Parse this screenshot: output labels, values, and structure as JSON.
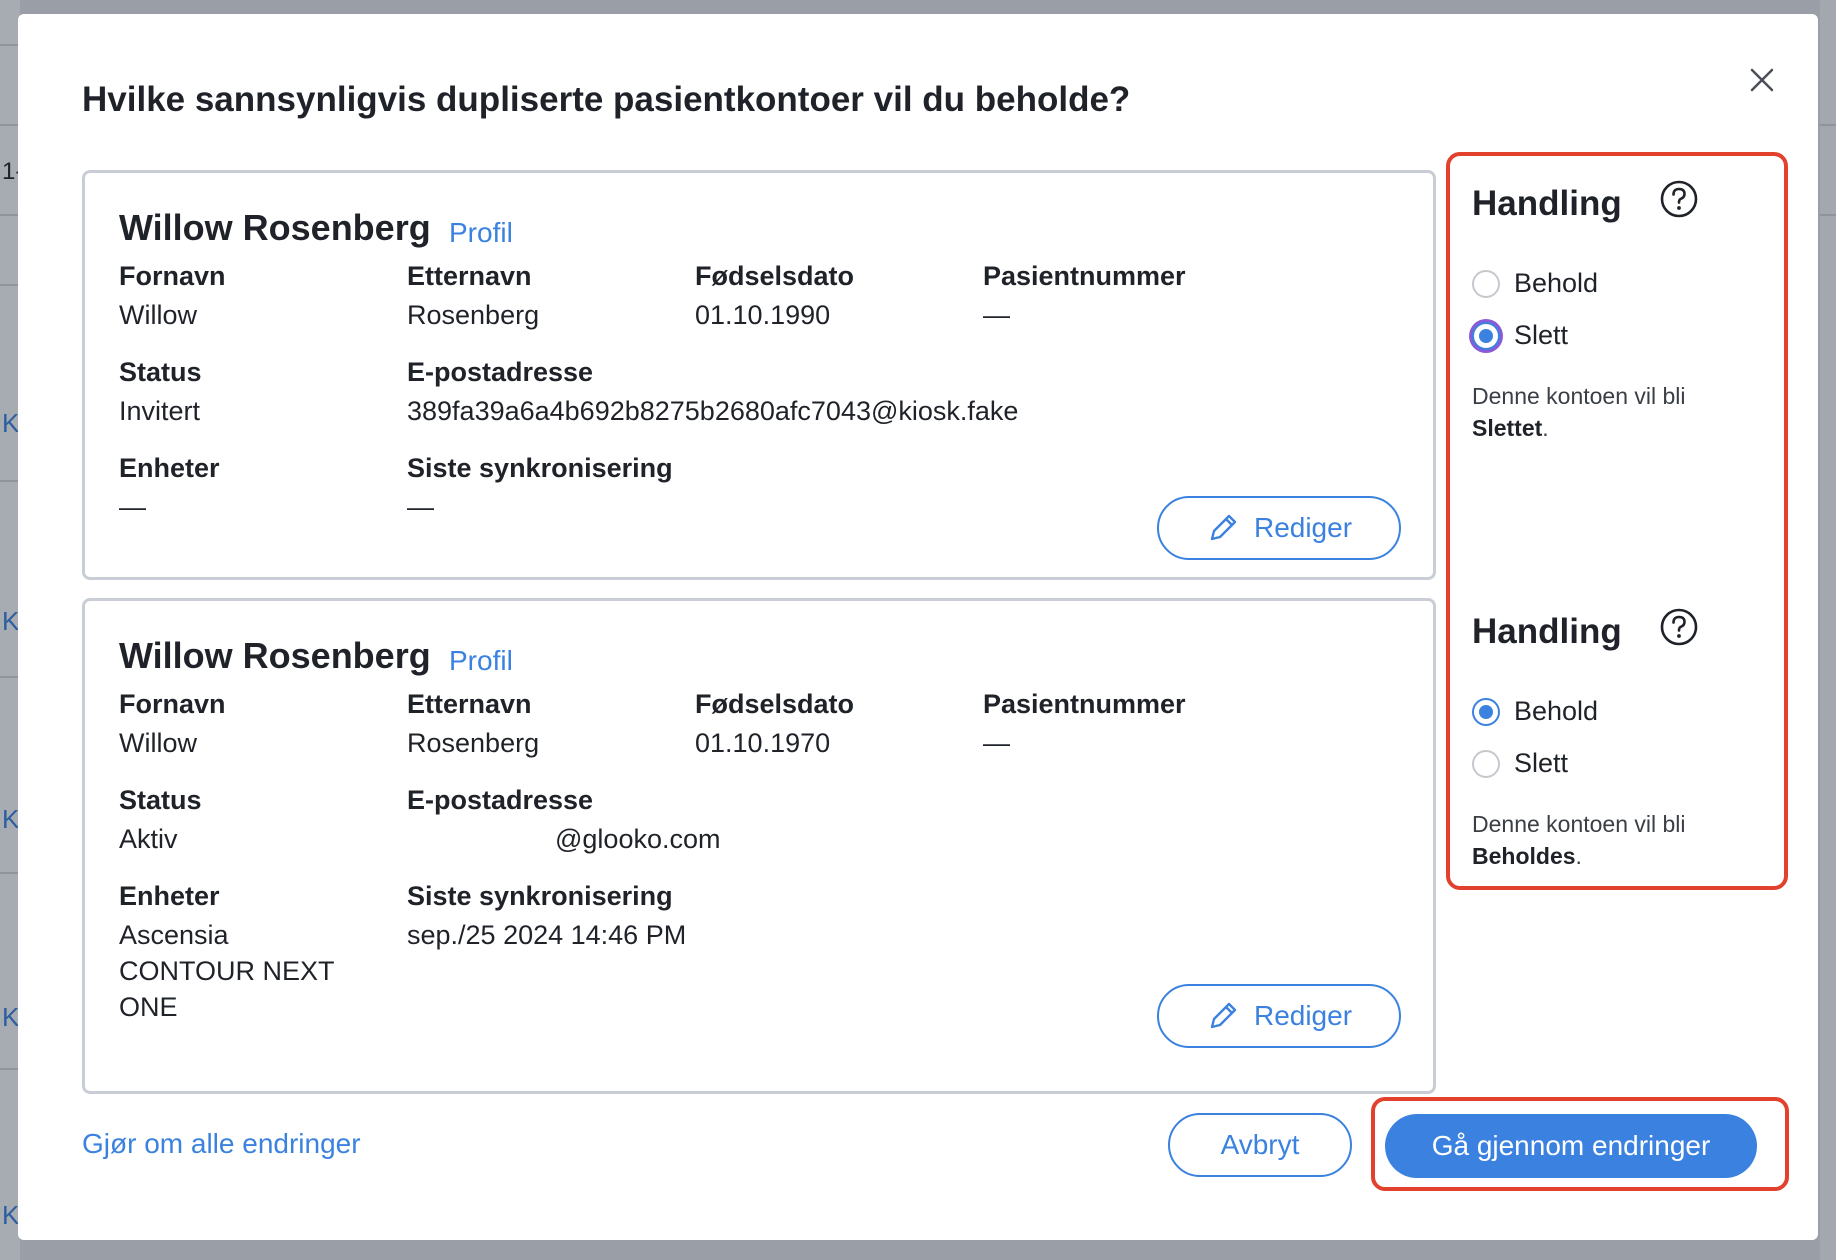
{
  "background": {
    "letters": [
      "1-",
      "K",
      "K",
      "K",
      "K",
      "K"
    ]
  },
  "modal": {
    "title": "Hvilke sannsynligvis dupliserte pasientkontoer vil du beholde?",
    "close_icon": "close-icon"
  },
  "cards": [
    {
      "name": "Willow Rosenberg",
      "profile_link": "Profil",
      "first_name_label": "Fornavn",
      "first_name": "Willow",
      "last_name_label": "Etternavn",
      "last_name": "Rosenberg",
      "dob_label": "Fødselsdato",
      "dob": "01.10.1990",
      "patient_number_label": "Pasientnummer",
      "patient_number": "—",
      "status_label": "Status",
      "status": "Invitert",
      "email_label": "E-postadresse",
      "email": "389fa39a6a4b692b8275b2680afc7043@kiosk.fake",
      "devices_label": "Enheter",
      "devices": [
        "—"
      ],
      "last_sync_label": "Siste synkronisering",
      "last_sync": "—",
      "edit_label": "Rediger"
    },
    {
      "name": "Willow Rosenberg",
      "profile_link": "Profil",
      "first_name_label": "Fornavn",
      "first_name": "Willow",
      "last_name_label": "Etternavn",
      "last_name": "Rosenberg",
      "dob_label": "Fødselsdato",
      "dob": "01.10.1970",
      "patient_number_label": "Pasientnummer",
      "patient_number": "—",
      "status_label": "Status",
      "status": "Aktiv",
      "email_label": "E-postadresse",
      "email": "@glooko.com",
      "devices_label": "Enheter",
      "devices": [
        "Ascensia",
        "CONTOUR NEXT",
        "ONE"
      ],
      "last_sync_label": "Siste synkronisering",
      "last_sync": "sep./25 2024 14:46 PM",
      "edit_label": "Rediger"
    }
  ],
  "actions": [
    {
      "title": "Handling",
      "help_icon": "question-circle-icon",
      "options": [
        {
          "label": "Behold",
          "selected": false
        },
        {
          "label": "Slett",
          "selected": true
        }
      ],
      "desc_prefix": "Denne kontoen vil bli",
      "desc_bold": "Slettet",
      "desc_suffix": "."
    },
    {
      "title": "Handling",
      "help_icon": "question-circle-icon",
      "options": [
        {
          "label": "Behold",
          "selected": true
        },
        {
          "label": "Slett",
          "selected": false
        }
      ],
      "desc_prefix": "Denne kontoen vil bli",
      "desc_bold": "Beholdes",
      "desc_suffix": "."
    }
  ],
  "footer": {
    "undo_label": "Gjør om alle endringer",
    "cancel_label": "Avbryt",
    "review_label": "Gå gjennom endringer"
  },
  "colors": {
    "accent": "#3b82e0",
    "highlight": "#e2412e",
    "focus_ring": "#8a5bd6"
  }
}
